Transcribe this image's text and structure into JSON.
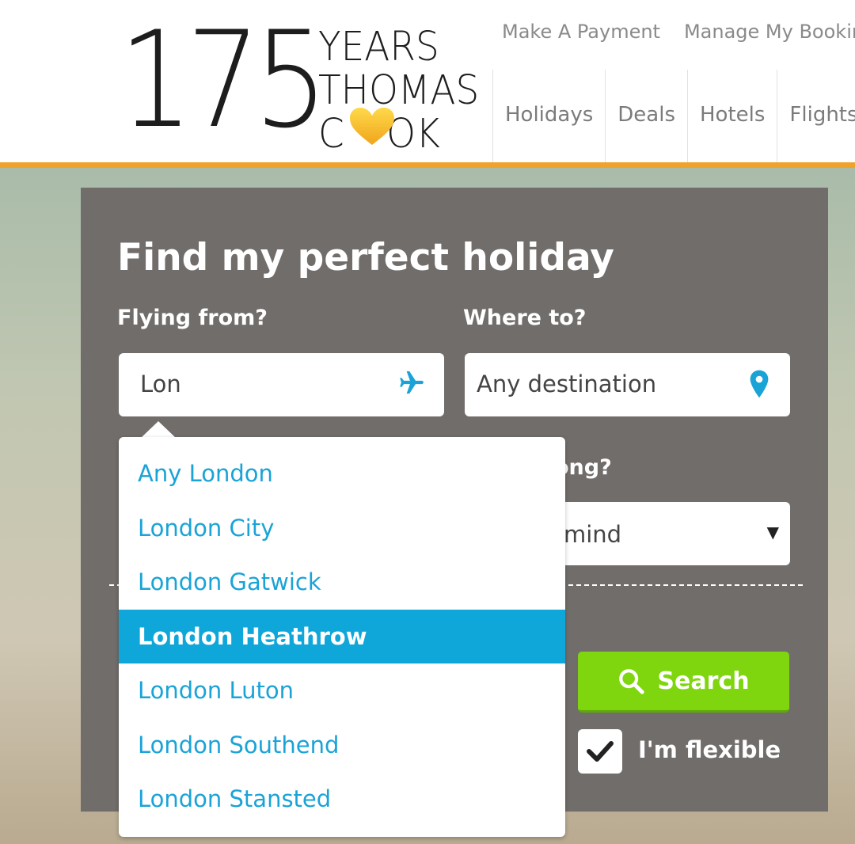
{
  "header": {
    "logo": {
      "number": "175",
      "line1": "YEARS",
      "line2": "THOMAS",
      "line3a": "C",
      "line3b": "OK"
    },
    "util_links": [
      "Make A Payment",
      "Manage My Booking"
    ],
    "nav": [
      "Holidays",
      "Deals",
      "Hotels",
      "Flights"
    ]
  },
  "search": {
    "title": "Find my perfect holiday",
    "flying_from_label": "Flying from?",
    "flying_from_value": "Lon",
    "where_to_label": "Where to?",
    "where_to_placeholder": "Any destination",
    "how_long_label_partial": "ong?",
    "how_long_value_partial": "mind",
    "search_button": "Search",
    "flexible_label": "I'm flexible",
    "flexible_checked": true
  },
  "dropdown": {
    "items": [
      "Any London",
      "London City",
      "London Gatwick",
      "London Heathrow",
      "London Luton",
      "London Southend",
      "London Stansted"
    ],
    "selected": "London Heathrow"
  },
  "colors": {
    "accent": "#0fa7da",
    "brand_orange": "#f0a22a",
    "search_green": "#7fd60f",
    "panel": "#716d6b"
  }
}
